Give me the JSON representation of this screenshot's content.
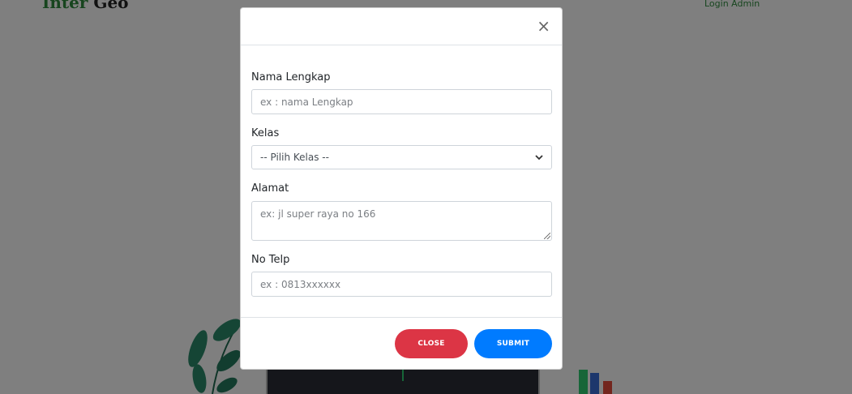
{
  "background": {
    "brand": {
      "part1": "Inter",
      "part2": " Geo"
    },
    "login_link": "Login Admin"
  },
  "modal": {
    "close_icon_glyph": "×",
    "fields": {
      "nama": {
        "label": "Nama Lengkap",
        "placeholder": "ex : nama Lengkap"
      },
      "kelas": {
        "label": "Kelas",
        "selected": "-- Pilih Kelas --"
      },
      "alamat": {
        "label": "Alamat",
        "placeholder": "ex: jl super raya no 166"
      },
      "telp": {
        "label": "No Telp",
        "placeholder": "ex : 0813xxxxxx"
      }
    },
    "buttons": {
      "close": "CLOSE",
      "submit": "SUBMIT"
    }
  },
  "colors": {
    "close_button": "#dc3545",
    "submit_button": "#007bff",
    "brand_accent": "#2e8b3d"
  }
}
